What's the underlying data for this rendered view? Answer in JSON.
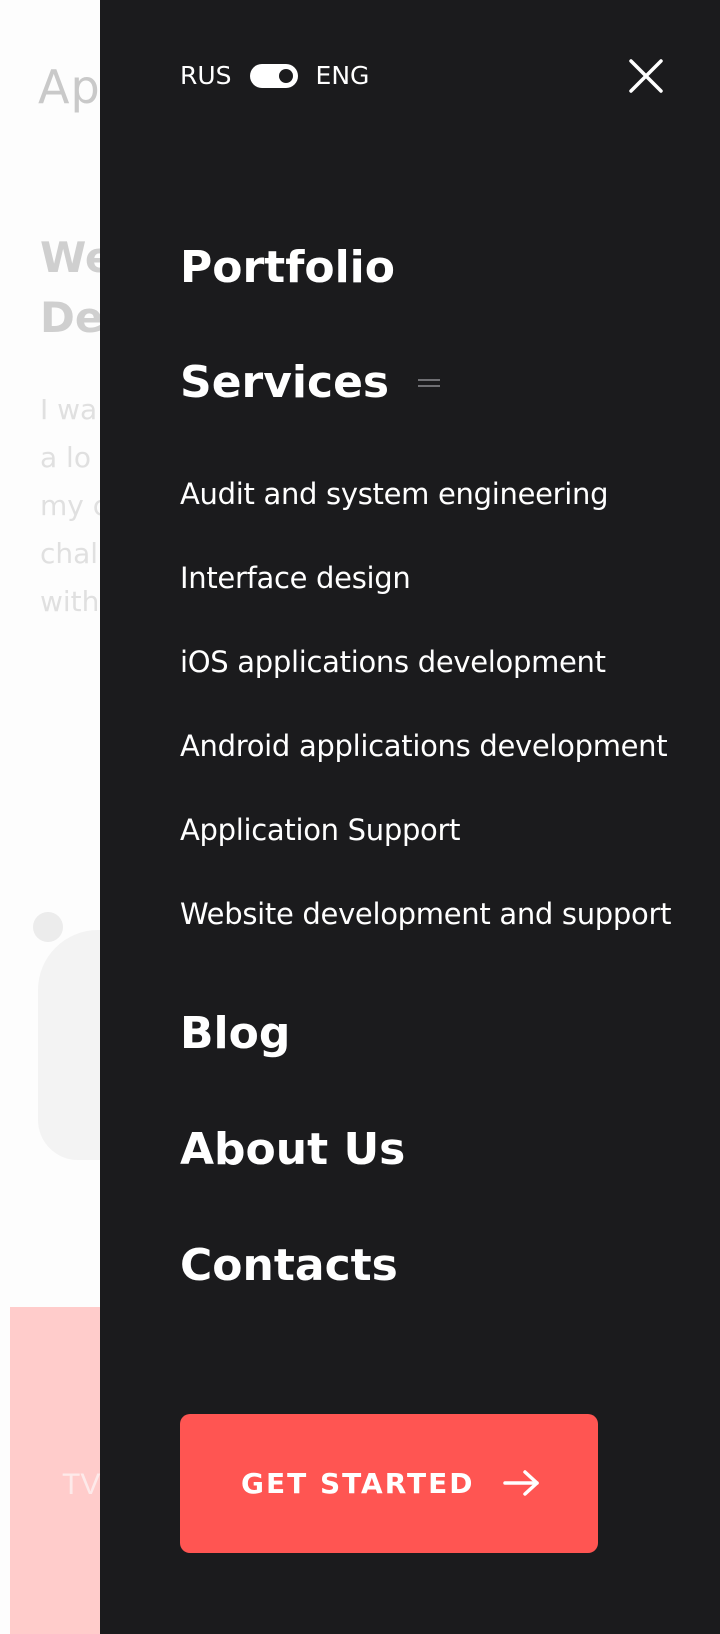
{
  "background": {
    "logo": "Ap",
    "heading_line1": "We",
    "heading_line2": "De",
    "text_lines": [
      "I wa",
      "a lo",
      "my c",
      "chall",
      "with"
    ],
    "banner_text": "TV"
  },
  "drawer": {
    "lang": {
      "left": "RUS",
      "right": "ENG",
      "selected": "ENG"
    },
    "close_icon": "close-icon",
    "menu": {
      "portfolio": "Portfolio",
      "services": "Services",
      "services_sub": [
        "Audit and system engineering",
        "Interface design",
        "iOS applications development",
        "Android applications development",
        "Application Support",
        "Website development and support"
      ],
      "blog": "Blog",
      "about": "About Us",
      "contacts": "Contacts"
    },
    "cta": {
      "label": "GET STARTED",
      "icon": "arrow-right-icon"
    }
  },
  "colors": {
    "drawer_bg": "#1b1b1d",
    "accent": "#ff5552",
    "banner_bg": "#ffcccb"
  }
}
